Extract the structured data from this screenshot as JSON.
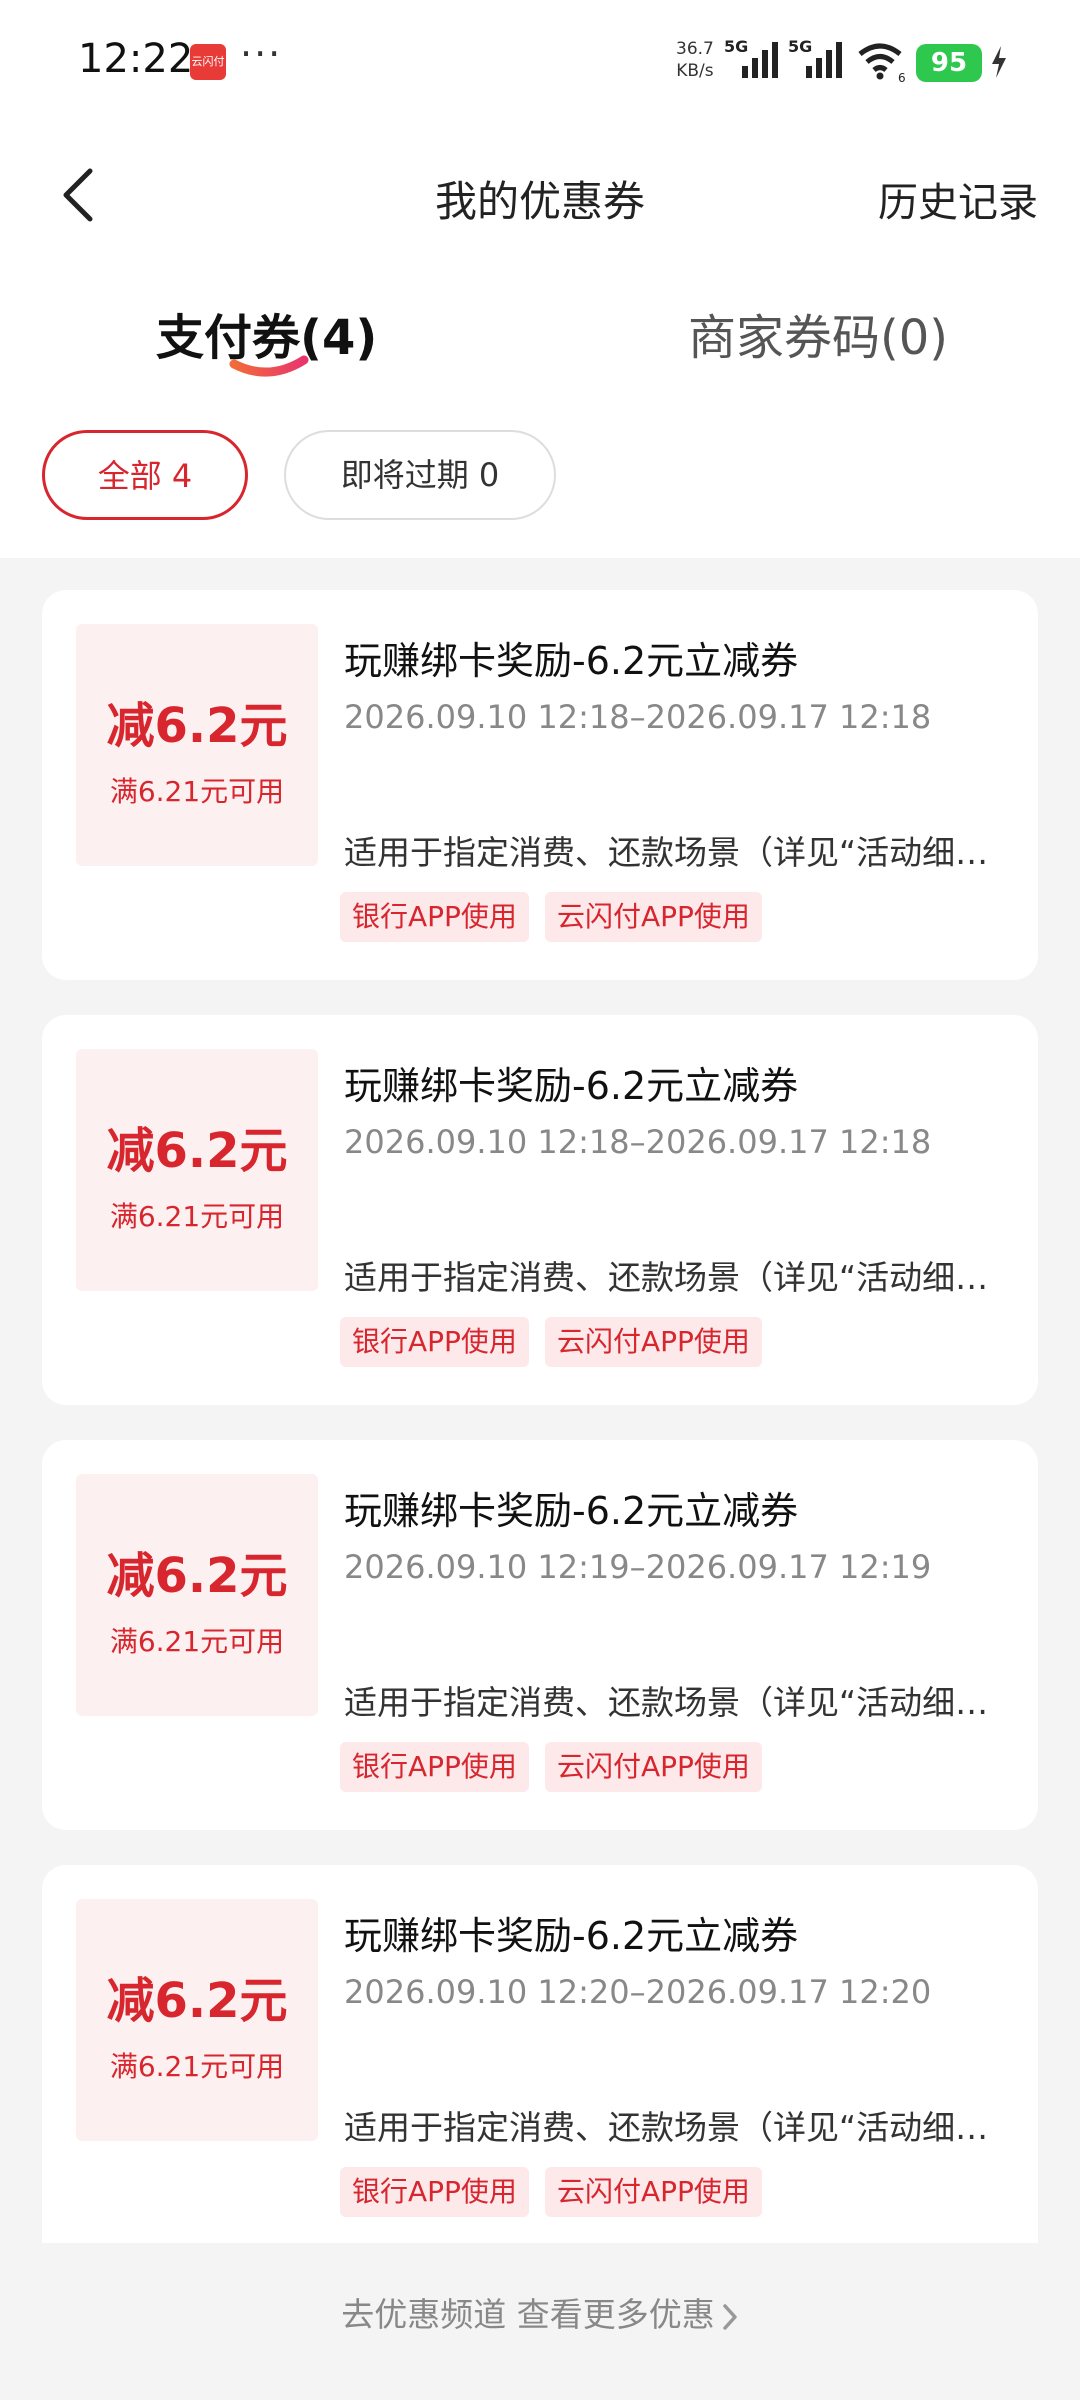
{
  "status_bar": {
    "time": "12:22",
    "app_icon_label": "云闪付",
    "more": "···",
    "speed_value": "36.7",
    "speed_unit": "KB/s",
    "net1": "5G",
    "net2": "5G",
    "wifi_label": "6",
    "battery": "95"
  },
  "header": {
    "title": "我的优惠券",
    "history_label": "历史记录"
  },
  "tabs": [
    {
      "label": "支付券(4)",
      "active": true
    },
    {
      "label": "商家券码(0)",
      "active": false
    }
  ],
  "filters": [
    {
      "label": "全部 4",
      "selected": true
    },
    {
      "label": "即将过期 0",
      "selected": false
    }
  ],
  "coupons": [
    {
      "amount": "减6.2元",
      "condition": "满6.21元可用",
      "title": "玩赚绑卡奖励-6.2元立减券",
      "validity": "2026.09.10 12:18–2026.09.17 12:18",
      "description": "适用于指定消费、还款场景（详见“活动细则”）",
      "tags": [
        "银行APP使用",
        "云闪付APP使用"
      ]
    },
    {
      "amount": "减6.2元",
      "condition": "满6.21元可用",
      "title": "玩赚绑卡奖励-6.2元立减券",
      "validity": "2026.09.10 12:18–2026.09.17 12:18",
      "description": "适用于指定消费、还款场景（详见“活动细则”）",
      "tags": [
        "银行APP使用",
        "云闪付APP使用"
      ]
    },
    {
      "amount": "减6.2元",
      "condition": "满6.21元可用",
      "title": "玩赚绑卡奖励-6.2元立减券",
      "validity": "2026.09.10 12:19–2026.09.17 12:19",
      "description": "适用于指定消费、还款场景（详见“活动细则”）",
      "tags": [
        "银行APP使用",
        "云闪付APP使用"
      ]
    },
    {
      "amount": "减6.2元",
      "condition": "满6.21元可用",
      "title": "玩赚绑卡奖励-6.2元立减券",
      "validity": "2026.09.10 12:20–2026.09.17 12:20",
      "description": "适用于指定消费、还款场景（详见“活动细则”）",
      "tags": [
        "银行APP使用",
        "云闪付APP使用"
      ]
    }
  ],
  "footer": {
    "link_label": "去优惠频道 查看更多优惠"
  },
  "colors": {
    "accent": "#d7262e",
    "coupon_left_bg": "#fdf0f1",
    "tag_bg": "#fde8ea",
    "battery": "#2fc84f"
  },
  "icons": [
    "back-arrow-icon",
    "chevron-right-icon",
    "signal-icon",
    "wifi-icon",
    "battery-icon",
    "charging-icon"
  ]
}
